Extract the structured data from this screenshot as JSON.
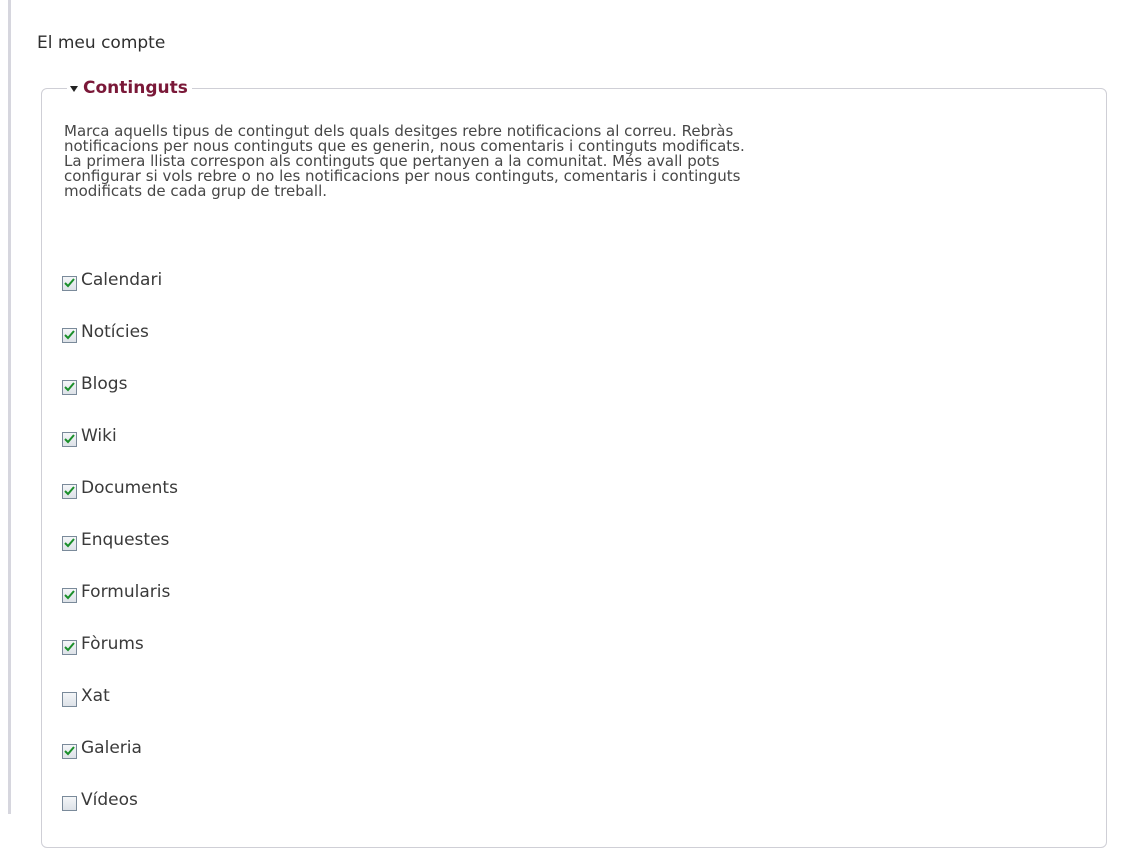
{
  "page": {
    "title": "El meu compte"
  },
  "fieldset": {
    "legend": "Continguts",
    "description_lines": [
      "Marca aquells tipus de contingut dels quals desitges rebre notificacions al correu. Rebràs",
      "notificacions per nous continguts que es generin, nous comentaris i continguts modificats.",
      "La primera llista correspon als continguts que pertanyen a la comunitat. Més avall pots",
      "configurar si vols rebre o no les notificacions per nous continguts, comentaris i continguts",
      "modificats de cada grup de treball."
    ],
    "options": [
      {
        "label": "Calendari",
        "checked": true
      },
      {
        "label": "Notícies",
        "checked": true
      },
      {
        "label": "Blogs",
        "checked": true
      },
      {
        "label": "Wiki",
        "checked": true
      },
      {
        "label": "Documents",
        "checked": true
      },
      {
        "label": "Enquestes",
        "checked": true
      },
      {
        "label": "Formularis",
        "checked": true
      },
      {
        "label": "Fòrums",
        "checked": true
      },
      {
        "label": "Xat",
        "checked": false
      },
      {
        "label": "Galeria",
        "checked": true
      },
      {
        "label": "Vídeos",
        "checked": false
      }
    ]
  },
  "colors": {
    "legend": "#7a1838",
    "check_mark": "#1a8f2a"
  }
}
